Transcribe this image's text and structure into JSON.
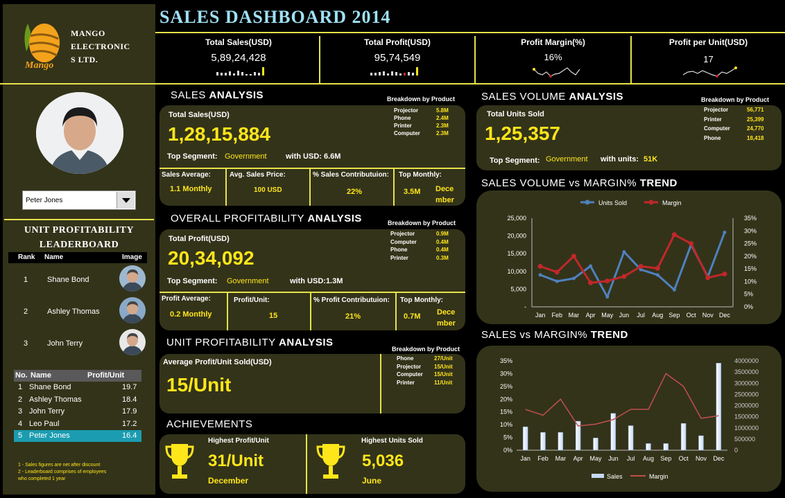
{
  "brand": {
    "name_line1": "MANGO",
    "name_line2": "ELECTRONIC",
    "name_line3": "S LTD.",
    "logo_text": "Mango",
    "colors": {
      "accent": "#ffe61a",
      "panel": "#33331a",
      "background": "#000000",
      "line": "#e7e34a"
    }
  },
  "title": "SALES DASHBOARD 2014",
  "kpis": [
    {
      "label": "Total Sales(USD)",
      "value": "5,89,24,428"
    },
    {
      "label": "Total Profit(USD)",
      "value": "95,74,549"
    },
    {
      "label": "Profit Margin(%)",
      "value": "16%"
    },
    {
      "label": "Profit per Unit(USD)",
      "value": "17"
    }
  ],
  "employee_select": {
    "value": "Peter Jones"
  },
  "leaderboard": {
    "title_line1": "UNIT PROFITABILITY",
    "title_line2": "LEADERBOARD",
    "headers": {
      "rank": "Rank",
      "name": "Name",
      "image": "Image"
    },
    "rows": [
      {
        "rank": "1",
        "name": "Shane Bond"
      },
      {
        "rank": "2",
        "name": "Ashley Thomas"
      },
      {
        "rank": "3",
        "name": "John Terry"
      }
    ]
  },
  "profit_table": {
    "headers": {
      "no": "No.",
      "name": "Name",
      "ppu": "Profit/Unit"
    },
    "rows": [
      {
        "no": "1",
        "name": "Shane Bond",
        "ppu": "19.7"
      },
      {
        "no": "2",
        "name": "Ashley Thomas",
        "ppu": "18.4"
      },
      {
        "no": "3",
        "name": "John Terry",
        "ppu": "17.9"
      },
      {
        "no": "4",
        "name": "Leo Paul",
        "ppu": "17.2"
      },
      {
        "no": "5",
        "name": "Peter Jones",
        "ppu": "16.4"
      }
    ]
  },
  "footnotes": {
    "line1": "1 - Sales figures are net after discount",
    "line2": "2 - Leaderboard comprises of employees",
    "line3": "who completed 1 year"
  },
  "sales_analysis": {
    "title_plain": "SALES ",
    "title_bold": "ANALYSIS",
    "breakdown_label": "Breakdown by Product",
    "breakdown": [
      {
        "name": "Projector",
        "value": "5.8M"
      },
      {
        "name": "Phone",
        "value": "2.4M"
      },
      {
        "name": "Printer",
        "value": "2.3M"
      },
      {
        "name": "Computer",
        "value": "2.3M"
      }
    ],
    "total_label": "Total Sales(USD)",
    "total_value": "1,28,15,884",
    "segment_label": "Top Segment:",
    "segment_value": "Government",
    "with_label": "with USD: 6.6M",
    "metrics": [
      {
        "label": "Sales Average:",
        "value": "1.1 Monthly"
      },
      {
        "label": "Avg. Sales Price:",
        "value": "100 USD"
      },
      {
        "label": "% Sales Contributuion:",
        "value": "22%"
      },
      {
        "label": "Top Monthly:",
        "value": "3.5M",
        "extra1": "Dece",
        "extra2": "mber"
      }
    ]
  },
  "profit_analysis": {
    "title_plain": "OVERALL PROFITABILITY ",
    "title_bold": "ANALYSIS",
    "breakdown_label": "Breakdown by Product",
    "breakdown": [
      {
        "name": "Projector",
        "value": "0.9M"
      },
      {
        "name": "Computer",
        "value": "0.4M"
      },
      {
        "name": "Phone",
        "value": "0.4M"
      },
      {
        "name": "Printer",
        "value": "0.3M"
      }
    ],
    "total_label": "Total Profit(USD)",
    "total_value": "20,34,092",
    "segment_label": "Top Segment:",
    "segment_value": "Government",
    "with_label": "with USD:1.3M",
    "metrics": [
      {
        "label": "Profit Average:",
        "value": "0.2 Monthly"
      },
      {
        "label": "Profit/Unit:",
        "value": "15"
      },
      {
        "label": "% Profit Contributuion:",
        "value": "21%"
      },
      {
        "label": "Top Monthly:",
        "value": "0.7M",
        "extra1": "Dece",
        "extra2": "mber"
      }
    ]
  },
  "unit_analysis": {
    "title_plain": "UNIT PROFITABILITY ",
    "title_bold": "ANALYSIS",
    "breakdown_label": "Breakdown by Product",
    "breakdown": [
      {
        "name": "Phone",
        "value": "27/Unit"
      },
      {
        "name": "Projector",
        "value": "15/Unit"
      },
      {
        "name": "Computer",
        "value": "15/Unit"
      },
      {
        "name": "Printer",
        "value": "11/Unit"
      }
    ],
    "avg_label": "Average Profit/Unit Sold(USD)",
    "avg_value": "15/Unit"
  },
  "achievements": {
    "title": "ACHIEVEMENTS",
    "items": [
      {
        "label": "Highest Profit/Unit",
        "value": "31/Unit",
        "sub": "December"
      },
      {
        "label": "Highest Units Sold",
        "value": "5,036",
        "sub": "June"
      }
    ]
  },
  "volume_analysis": {
    "title_plain": "SALES VOLUME ",
    "title_bold": "ANALYSIS",
    "breakdown_label": "Breakdown by Product",
    "breakdown": [
      {
        "name": "Projector",
        "value": "56,771"
      },
      {
        "name": "Printer",
        "value": "25,399"
      },
      {
        "name": "Computer",
        "value": "24,770"
      },
      {
        "name": "Phone",
        "value": "18,418"
      }
    ],
    "total_label": "Total Units Sold",
    "total_value": "1,25,357",
    "segment_label": "Top Segment:",
    "segment_value": "Government",
    "with_label": "with units:",
    "with_value": "51K"
  },
  "trend1_title": {
    "plain": "SALES VOLUME vs MARGIN% ",
    "bold": "TREND"
  },
  "trend2_title": {
    "plain": "SALES vs MARGIN% ",
    "bold": "TREND"
  },
  "chart_data": [
    {
      "type": "line",
      "categories": [
        "Jan",
        "Feb",
        "Mar",
        "Apr",
        "May",
        "Jun",
        "Jul",
        "Aug",
        "Sep",
        "Oct",
        "Nov",
        "Dec"
      ],
      "series": [
        {
          "name": "Units Sold",
          "axis": "left",
          "color": "#4f81bd",
          "values": [
            9000,
            7200,
            8000,
            11500,
            2800,
            15500,
            10500,
            9000,
            4800,
            17500,
            8500,
            21000
          ]
        },
        {
          "name": "Margin",
          "axis": "right",
          "color": "#c0282a",
          "values": [
            0.16,
            0.137,
            0.2,
            0.095,
            0.102,
            0.12,
            0.16,
            0.152,
            0.285,
            0.25,
            0.115,
            0.13
          ]
        }
      ],
      "left_ticks": [
        "25,000",
        "20,000",
        "15,000",
        "10,000",
        "5,000",
        "-"
      ],
      "right_ticks": [
        "35%",
        "30%",
        "25%",
        "20%",
        "15%",
        "10%",
        "5%",
        "0%"
      ],
      "ylim_left": [
        0,
        25000
      ],
      "ylim_right": [
        0,
        0.35
      ],
      "legend": "top"
    },
    {
      "type": "bar",
      "categories": [
        "Jan",
        "Feb",
        "Mar",
        "Apr",
        "May",
        "Jun",
        "Jul",
        "Aug",
        "Sep",
        "Oct",
        "Nov",
        "Dec"
      ],
      "series": [
        {
          "name": "Sales",
          "axis": "right",
          "color": "#c6d9f1",
          "values": [
            1050000,
            800000,
            800000,
            1300000,
            550000,
            1650000,
            1100000,
            300000,
            300000,
            1200000,
            650000,
            3900000
          ]
        },
        {
          "name": "Margin",
          "axis": "left",
          "color": "#c0504d",
          "values": [
            0.16,
            0.137,
            0.2,
            0.095,
            0.102,
            0.12,
            0.16,
            0.16,
            0.3,
            0.25,
            0.125,
            0.135
          ]
        }
      ],
      "left_ticks": [
        "35%",
        "30%",
        "25%",
        "20%",
        "15%",
        "10%",
        "5%",
        "0%"
      ],
      "right_ticks": [
        "4000000",
        "3500000",
        "3000000",
        "2500000",
        "2000000",
        "1500000",
        "1000000",
        "500000",
        "0"
      ],
      "ylim_left": [
        0,
        0.35
      ],
      "ylim_right": [
        0,
        4000000
      ],
      "legend": "bottom"
    }
  ]
}
